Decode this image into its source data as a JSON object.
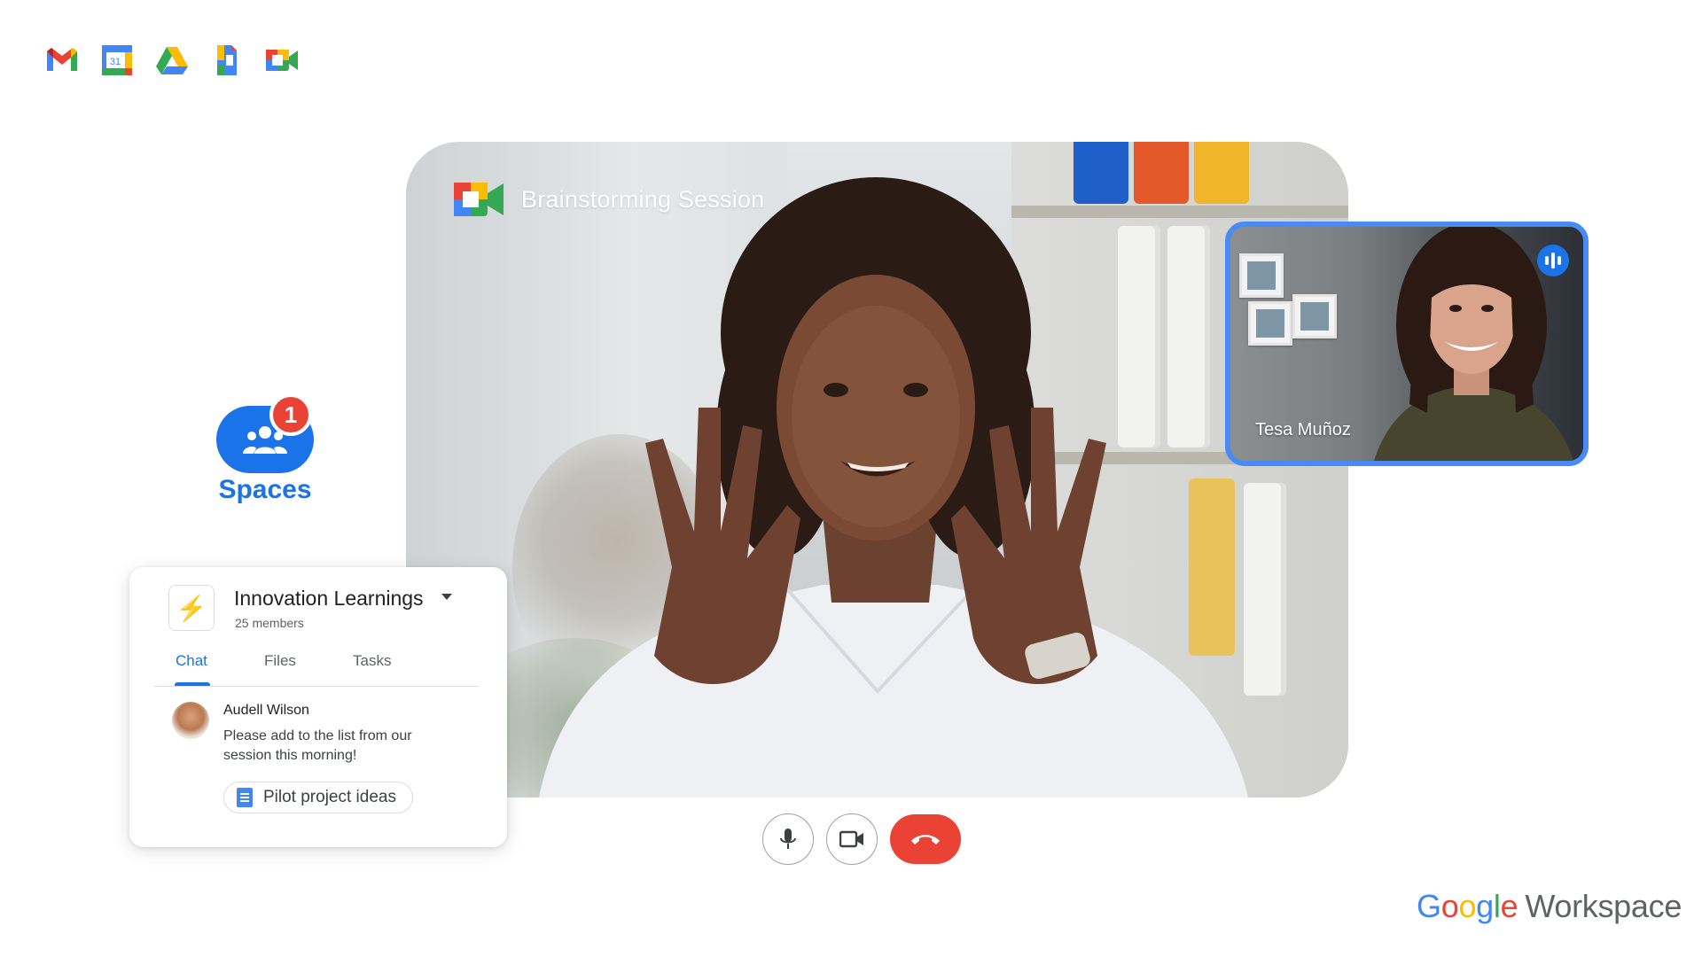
{
  "apps": [
    {
      "name": "Gmail",
      "icon": "gmail-icon"
    },
    {
      "name": "Calendar",
      "icon": "calendar-icon",
      "day": "31"
    },
    {
      "name": "Drive",
      "icon": "drive-icon"
    },
    {
      "name": "Docs",
      "icon": "docs-icon"
    },
    {
      "name": "Meet",
      "icon": "meet-icon"
    }
  ],
  "meeting": {
    "title": "Brainstorming Session",
    "pip_participant": "Tesa Muñoz"
  },
  "spaces": {
    "label": "Spaces",
    "badge": "1"
  },
  "chat_card": {
    "space_name": "Innovation Learnings",
    "members": "25 members",
    "tabs": [
      "Chat",
      "Files",
      "Tasks"
    ],
    "active_tab": "Chat",
    "message": {
      "sender": "Audell Wilson",
      "text": "Please add to the list from our session this morning!",
      "attachment": "Pilot project ideas"
    }
  },
  "controls": [
    "mic-icon",
    "camera-icon",
    "end-call-icon"
  ],
  "brand": {
    "google": [
      "G",
      "o",
      "o",
      "g",
      "l",
      "e"
    ],
    "google_colors": [
      "#4285f4",
      "#ea4335",
      "#fbbc04",
      "#4285f4",
      "#34a853",
      "#ea4335"
    ],
    "product": "Workspace"
  },
  "colors": {
    "accent": "#1a73e8",
    "danger": "#ea4335",
    "pip_border": "#4a8af4"
  }
}
